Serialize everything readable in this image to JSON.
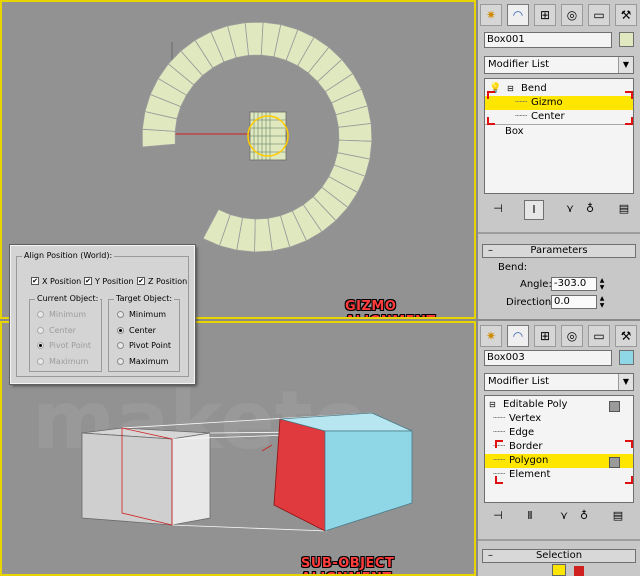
{
  "callouts": {
    "gizmo": "GIZMO ALIGNMENT",
    "subobject": "SUB-OBJECT ALIGNMENT"
  },
  "colors": {
    "accent": "#ffe600",
    "callout": "#ff3b3b",
    "poly_red": "#e0393e",
    "poly_cyan": "#8fd6e6",
    "bend_tint": "#dfe8bf"
  },
  "panel_top": {
    "tab_icons": [
      "light-sparkle-icon",
      "modify-curve-icon",
      "hierarchy-icon",
      "motion-icon",
      "display-icon",
      "utilities-hammer-icon"
    ],
    "object_name": "Box001",
    "modifier_list": "Modifier List",
    "stack": [
      "Bend",
      "Gizmo",
      "Center",
      "Box"
    ],
    "selected": "Gizmo",
    "rollout_title": "Parameters",
    "bend_label": "Bend:",
    "angle_label": "Angle:",
    "angle_value": "-303.0",
    "direction_label": "Direction:",
    "direction_value": "0.0"
  },
  "panel_bottom": {
    "object_name": "Box003",
    "modifier_list": "Modifier List",
    "stack": [
      "Editable Poly",
      "Vertex",
      "Edge",
      "Border",
      "Polygon",
      "Element"
    ],
    "selected": "Polygon",
    "rollout_title": "Selection"
  },
  "align_dialog": {
    "group_title": "Align Position (World):",
    "x_label": "X Position",
    "y_label": "Y Position",
    "z_label": "Z Position",
    "current_title": "Current Object:",
    "target_title": "Target Object:",
    "options": [
      "Minimum",
      "Center",
      "Pivot Point",
      "Maximum"
    ],
    "current_selected": "Pivot Point",
    "target_selected": "Center"
  },
  "watermark": "maketo"
}
